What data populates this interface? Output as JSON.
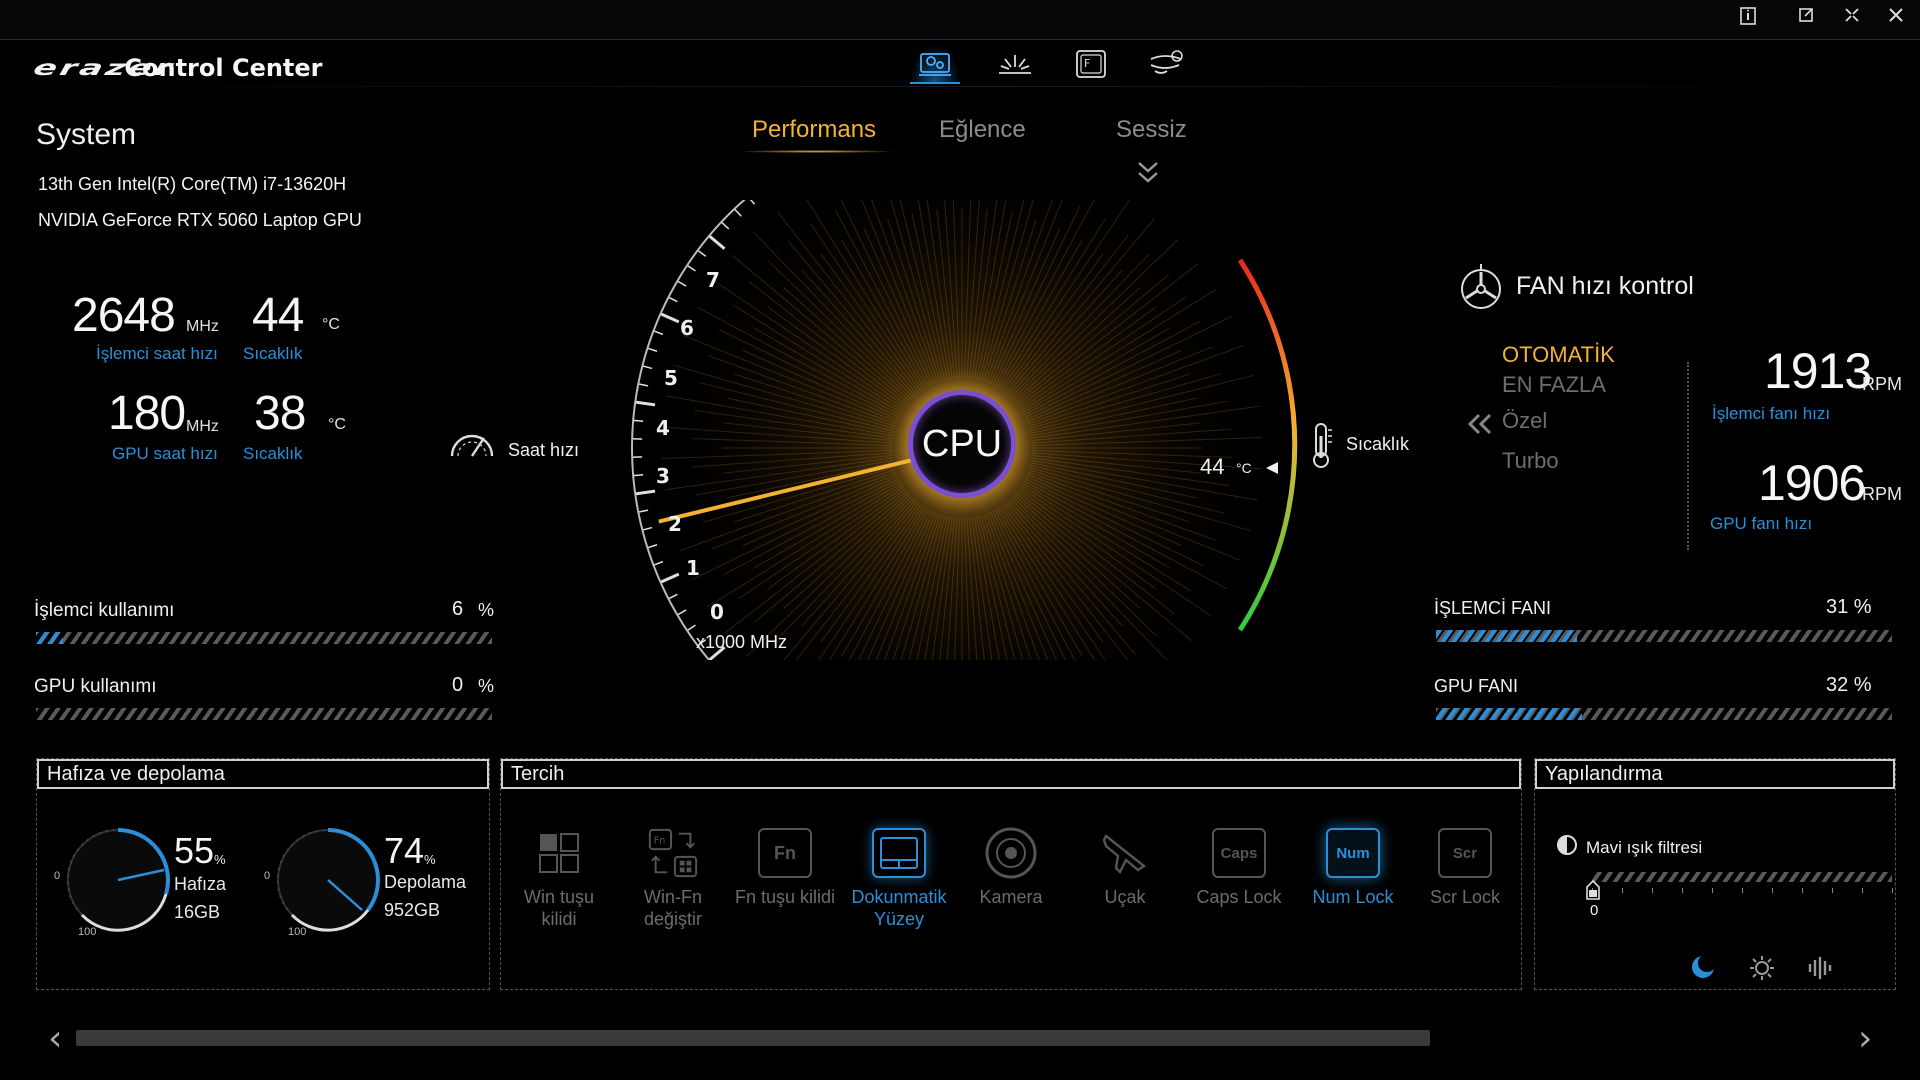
{
  "header": {
    "brand_logo": "erazer",
    "brand_title": "Control Center",
    "icons": [
      "system-settings-icon",
      "lighting-icon",
      "fn-key-icon",
      "fan-settings-icon"
    ]
  },
  "window_controls": [
    "info-icon",
    "restore-icon",
    "minimize-icon",
    "close-icon"
  ],
  "system": {
    "title": "System",
    "cpu_name": "13th Gen Intel(R) Core(TM) i7-13620H",
    "gpu_name": "NVIDIA GeForce RTX 5060 Laptop GPU",
    "cpu_clock": "2648",
    "cpu_clock_unit": "MHz",
    "cpu_clock_label": "İşlemci saat hızı",
    "cpu_temp": "44",
    "cpu_temp_unit": "°C",
    "cpu_temp_label": "Sıcaklık",
    "gpu_clock": "180",
    "gpu_clock_unit": "MHz",
    "gpu_clock_label": "GPU saat hızı",
    "gpu_temp": "38",
    "gpu_temp_unit": "°C",
    "gpu_temp_label": "Sıcaklık"
  },
  "modes": {
    "tabs": [
      "Performans",
      "Eğlence",
      "Sessiz"
    ],
    "active": "Performans"
  },
  "gauge": {
    "center_label": "CPU",
    "clock_label": "Saat hızı",
    "scale_unit": "x1000 MHz",
    "scale_ticks": [
      "0",
      "1",
      "2",
      "3",
      "4",
      "5",
      "6",
      "7"
    ],
    "clock_value_ghz": 2.648,
    "temp_label": "Sıcaklık",
    "temp_value": "44",
    "temp_unit": "°C",
    "colors": {
      "needle": "#f4b234",
      "ring": "#7a4fd0",
      "temp_hot": "#e8281e",
      "temp_mid": "#f4b234",
      "temp_cool": "#2ecc40"
    }
  },
  "fan": {
    "title": "FAN hızı kontrol",
    "modes": [
      "OTOMATİK",
      "EN FAZLA",
      "Özel",
      "Turbo"
    ],
    "active_mode": "OTOMATİK",
    "cpu_rpm": "1913",
    "cpu_rpm_label": "İşlemci fanı hızı",
    "gpu_rpm": "1906",
    "gpu_rpm_label": "GPU fanı hızı",
    "rpm_unit": "RPM"
  },
  "usage": {
    "cpu_label": "İşlemci kullanımı",
    "cpu_value": "6",
    "cpu_pct": 6,
    "gpu_label": "GPU kullanımı",
    "gpu_value": "0",
    "gpu_pct": 0,
    "percent_sign": "%"
  },
  "fan_load": {
    "cpu_label": "İŞLEMCİ FANI",
    "cpu_value": "31 %",
    "cpu_pct": 31,
    "gpu_label": "GPU FANI",
    "gpu_value": "32 %",
    "gpu_pct": 32
  },
  "memory": {
    "title": "Hafıza ve depolama",
    "ram_pct": "55",
    "ram_label": "Hafıza",
    "ram_size": "16GB",
    "disk_pct": "74",
    "disk_label": "Depolama",
    "disk_size": "952GB",
    "axis_min": "0",
    "axis_max": "100",
    "pct_sign": "%"
  },
  "preferences": {
    "title": "Tercih",
    "items": [
      {
        "label": "Win tuşu kilidi",
        "icon": "windows-key-icon",
        "on": false
      },
      {
        "label": "Win-Fn değiştir",
        "icon": "win-fn-swap-icon",
        "on": false
      },
      {
        "label": "Fn tuşu kilidi",
        "icon": "fn-lock-icon",
        "on": false
      },
      {
        "label": "Dokunmatik Yüzey",
        "icon": "touchpad-icon",
        "on": true
      },
      {
        "label": "Kamera",
        "icon": "camera-icon",
        "on": false
      },
      {
        "label": "Uçak",
        "icon": "airplane-icon",
        "on": false
      },
      {
        "label": "Caps Lock",
        "icon": "caps-lock-icon",
        "on": false
      },
      {
        "label": "Num Lock",
        "icon": "num-lock-icon",
        "on": true
      },
      {
        "label": "Scr Lock",
        "icon": "scroll-lock-icon",
        "on": false
      }
    ],
    "key_caps": {
      "fn": "Fn",
      "caps": "Caps",
      "num": "Num",
      "scr": "Scr"
    }
  },
  "configuration": {
    "title": "Yapılandırma",
    "blue_light_label": "Mavi ışık filtresi",
    "blue_light_value": "0",
    "blue_light_level": 0,
    "bottom_icons": [
      "moon-icon",
      "brightness-icon",
      "sound-icon"
    ]
  }
}
